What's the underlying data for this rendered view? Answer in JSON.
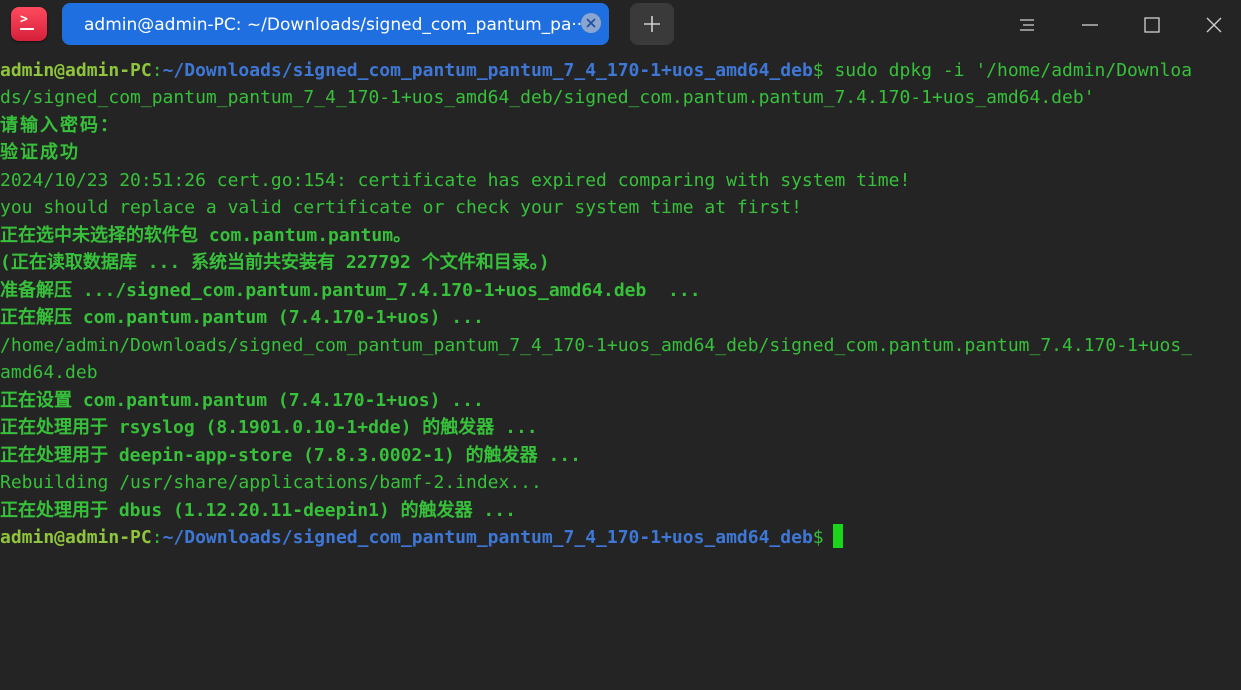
{
  "window": {
    "tab_title": "admin@admin-PC: ~/Downloads/signed_com_pantum_pa··",
    "icons": {
      "app": "deepin-terminal-icon",
      "tab_close": "close-icon",
      "new_tab": "plus-icon",
      "menu": "hamburger-menu-icon",
      "minimize": "minimize-icon",
      "maximize": "maximize-icon",
      "close": "close-icon"
    }
  },
  "terminal": {
    "colors": {
      "output": "#37c03a",
      "user": "#8fc53c",
      "path": "#3e77d6",
      "cursor": "#1ad61a"
    },
    "prompt1": {
      "user": "admin@admin-PC",
      "sep": ":",
      "path": "~/Downloads/signed_com_pantum_pantum_7_4_170-1+uos_amd64_deb",
      "dollar": "$",
      "command": " sudo dpkg -i '/home/admin/Downloa"
    },
    "lines": [
      "ds/signed_com_pantum_pantum_7_4_170-1+uos_amd64_deb/signed_com.pantum.pantum_7.4.170-1+uos_amd64.deb'",
      "请输入密码：",
      "验证成功",
      "2024/10/23 20:51:26 cert.go:154: certificate has expired comparing with system time!",
      "you should replace a valid certificate or check your system time at first!",
      "正在选中未选择的软件包 com.pantum.pantum。",
      "(正在读取数据库 ... 系统当前共安装有 227792 个文件和目录。)",
      "准备解压 .../signed_com.pantum.pantum_7.4.170-1+uos_amd64.deb  ...",
      "正在解压 com.pantum.pantum (7.4.170-1+uos) ...",
      "/home/admin/Downloads/signed_com_pantum_pantum_7_4_170-1+uos_amd64_deb/signed_com.pantum.pantum_7.4.170-1+uos_",
      "amd64.deb",
      "正在设置 com.pantum.pantum (7.4.170-1+uos) ...",
      "正在处理用于 rsyslog (8.1901.0.10-1+dde) 的触发器 ...",
      "正在处理用于 deepin-app-store (7.8.3.0002-1) 的触发器 ...",
      "Rebuilding /usr/share/applications/bamf-2.index...",
      "正在处理用于 dbus (1.12.20.11-deepin1) 的触发器 ..."
    ],
    "prompt2": {
      "user": "admin@admin-PC",
      "sep": ":",
      "path": "~/Downloads/signed_com_pantum_pantum_7_4_170-1+uos_amd64_deb",
      "dollar": "$"
    }
  }
}
